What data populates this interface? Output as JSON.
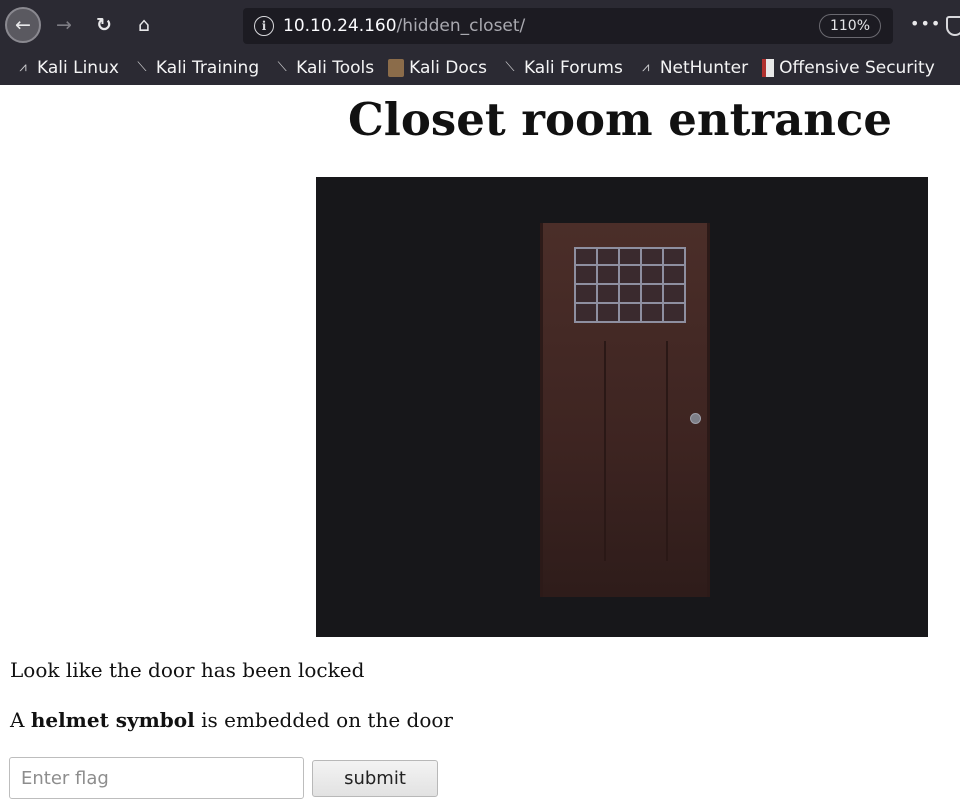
{
  "browser": {
    "url_host": "10.10.24.160",
    "url_path": "/hidden_closet/",
    "zoom": "110%",
    "bookmarks": [
      {
        "label": "Kali Linux"
      },
      {
        "label": "Kali Training"
      },
      {
        "label": "Kali Tools"
      },
      {
        "label": "Kali Docs"
      },
      {
        "label": "Kali Forums"
      },
      {
        "label": "NetHunter"
      },
      {
        "label": "Offensive Security"
      }
    ]
  },
  "page": {
    "title": "Closet room entrance",
    "message1": "Look like the door has been locked",
    "message2_prefix": "A ",
    "message2_bold": "helmet symbol",
    "message2_suffix": " is embedded on the door",
    "flag_placeholder": "Enter flag",
    "submit_label": "submit"
  }
}
